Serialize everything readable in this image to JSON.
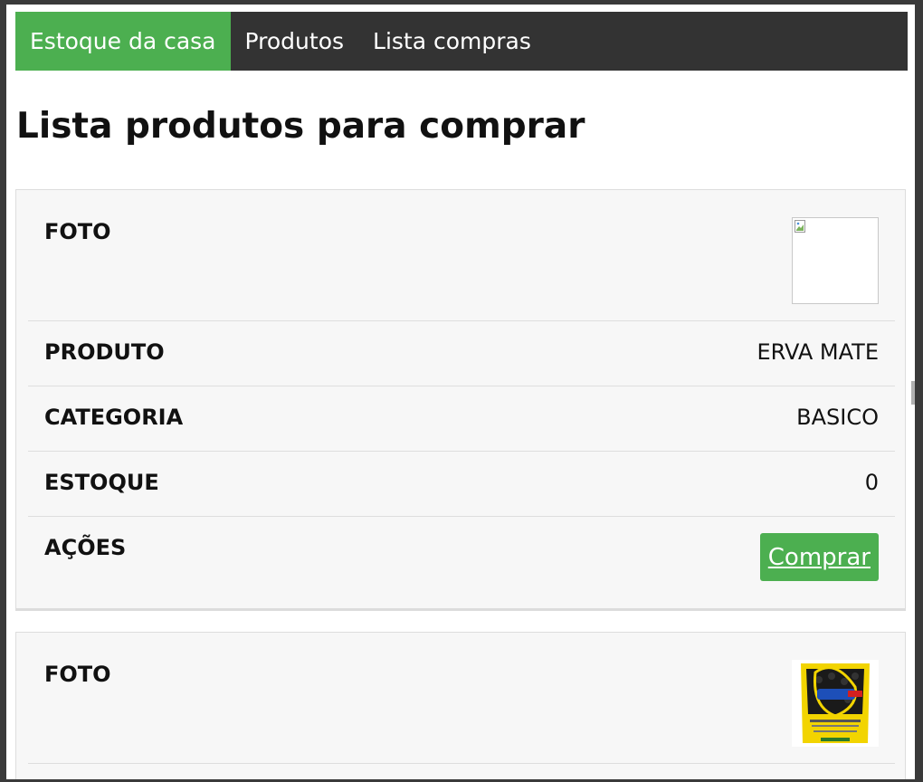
{
  "nav": {
    "items": [
      {
        "label": "Estoque da casa",
        "active": true
      },
      {
        "label": "Produtos",
        "active": false
      },
      {
        "label": "Lista compras",
        "active": false
      }
    ]
  },
  "page_title": "Lista produtos para comprar",
  "products": [
    {
      "foto_label": "FOTO",
      "foto_icon": "broken-image-icon",
      "produto_label": "PRODUTO",
      "produto_value": "ERVA MATE",
      "categoria_label": "CATEGORIA",
      "categoria_value": "BASICO",
      "estoque_label": "ESTOQUE",
      "estoque_value": "0",
      "acoes_label": "AÇÕES",
      "buy_label": "Comprar"
    },
    {
      "foto_label": "FOTO",
      "foto_icon": "bean-package-image"
    }
  ],
  "colors": {
    "navbar": "#333333",
    "active_nav": "#4caf50",
    "button": "#4caf50",
    "card_bg": "#f7f7f7"
  }
}
